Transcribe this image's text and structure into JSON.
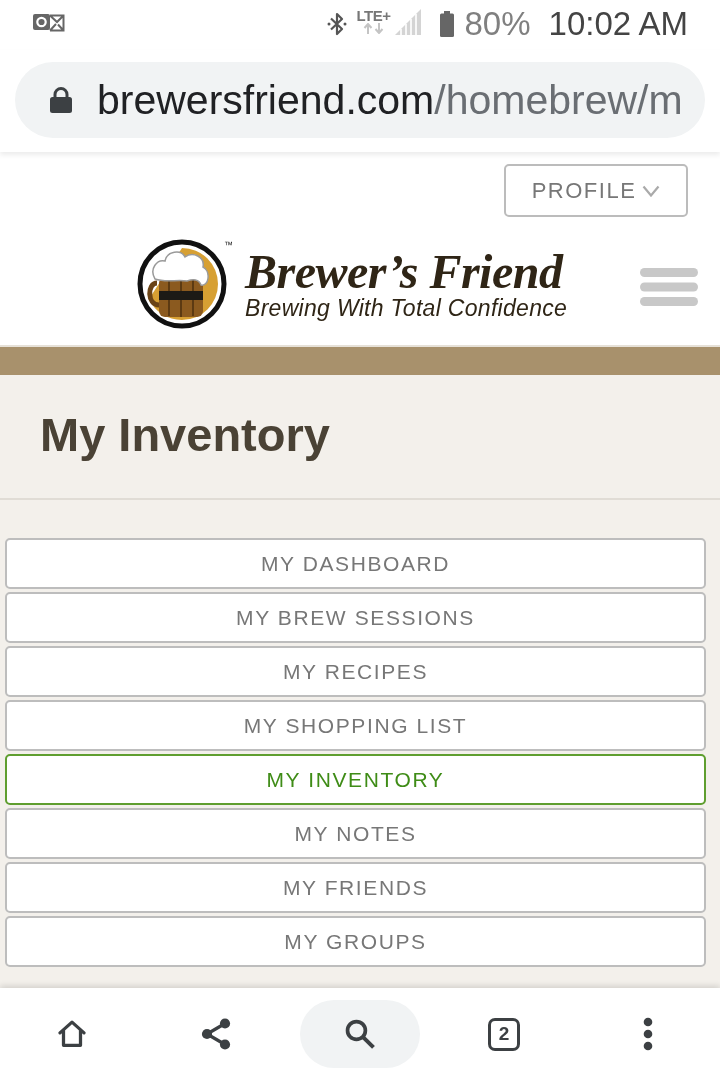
{
  "status_bar": {
    "network_type": "LTE+",
    "battery": "80%",
    "time": "10:02 AM"
  },
  "address_bar": {
    "host": "brewersfriend.com",
    "path": "/homebrew/m"
  },
  "header": {
    "profile_button": "PROFILE",
    "logo": {
      "trademark": "™",
      "name": "Brewer’s Friend",
      "tagline": "Brewing With Total Confidence"
    }
  },
  "page_title": "My Inventory",
  "nav_menu": [
    {
      "label": "MY DASHBOARD",
      "selected": false
    },
    {
      "label": "MY BREW SESSIONS",
      "selected": false
    },
    {
      "label": "MY RECIPES",
      "selected": false
    },
    {
      "label": "MY SHOPPING LIST",
      "selected": false
    },
    {
      "label": "MY INVENTORY",
      "selected": true
    },
    {
      "label": "MY NOTES",
      "selected": false
    },
    {
      "label": "MY FRIENDS",
      "selected": false
    },
    {
      "label": "MY GROUPS",
      "selected": false
    }
  ],
  "bottom_toolbar": [
    {
      "kind": "home"
    },
    {
      "kind": "share"
    },
    {
      "kind": "search"
    },
    {
      "kind": "tabs",
      "label": "2"
    },
    {
      "kind": "more"
    }
  ]
}
